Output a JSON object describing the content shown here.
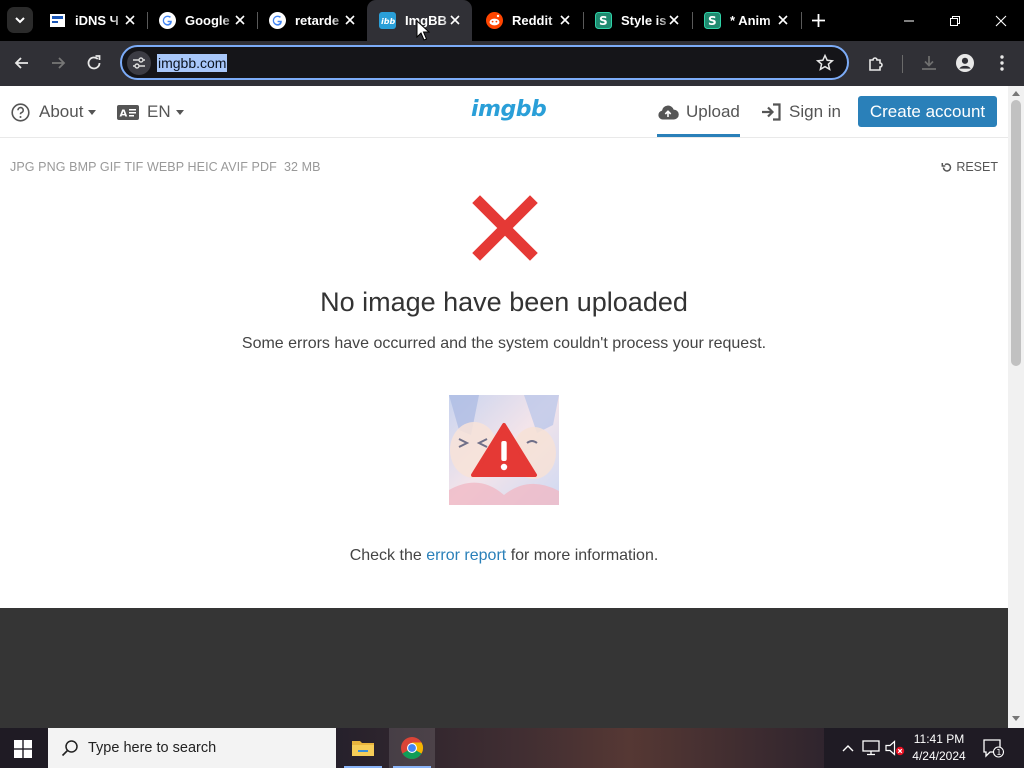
{
  "browser": {
    "tabs": [
      {
        "title": "iDNS Ч",
        "favicon": "idns-favicon"
      },
      {
        "title": "Google",
        "favicon": "google-favicon"
      },
      {
        "title": "retarde",
        "favicon": "google-favicon"
      },
      {
        "title": "ImgBB",
        "favicon": "imgbb-favicon",
        "active": true
      },
      {
        "title": "Reddit",
        "favicon": "reddit-favicon"
      },
      {
        "title": "Style is",
        "favicon": "stylus-favicon"
      },
      {
        "title": "* Anim",
        "favicon": "stylus-favicon"
      }
    ],
    "address": "imgbb.com",
    "accent": "#7cacf8"
  },
  "site": {
    "nav": {
      "about": "About",
      "language": "EN",
      "logo": "imgbb",
      "upload": "Upload",
      "signin": "Sign in",
      "create_account": "Create account"
    },
    "formats": "JPG PNG BMP GIF TIF WEBP HEIC AVIF PDF",
    "max_size": "32 MB",
    "reset": "RESET",
    "error": {
      "title": "No image have been uploaded",
      "message": "Some errors have occurred and the system couldn't process your request.",
      "check_prefix": "Check the",
      "link": "error report",
      "check_suffix": "for more information."
    },
    "colors": {
      "brand": "#2a9fd8",
      "button": "#2a80b9",
      "error_red": "#e53935",
      "footer": "#353535"
    }
  },
  "taskbar": {
    "search_placeholder": "Type here to search",
    "time": "11:41 PM",
    "date": "4/24/2024",
    "notification_count": "1",
    "apps": [
      "file-explorer-icon",
      "chrome-icon"
    ]
  }
}
